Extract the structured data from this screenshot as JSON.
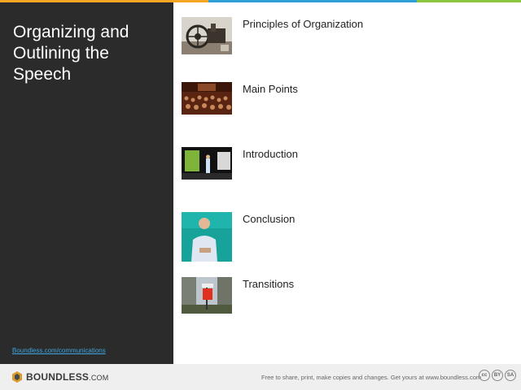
{
  "slide": {
    "title": "Organizing and Outlining the Speech",
    "source_link": "Boundless.com/communications"
  },
  "items": [
    {
      "label": "Principles of Organization",
      "image": "antique-machinery-photo"
    },
    {
      "label": "Main Points",
      "image": "audience-hall-photo"
    },
    {
      "label": "Introduction",
      "image": "stage-presenter-photo"
    },
    {
      "label": "Conclusion",
      "image": "speaker-portrait-photo"
    },
    {
      "label": "Transitions",
      "image": "street-sign-photo"
    }
  ],
  "footer": {
    "logo_main": "BOUNDLESS",
    "logo_suffix": ".COM",
    "note": "Free to share, print, make copies and changes. Get yours at www.boundless.com",
    "license_cc": "cc",
    "license_by": "BY",
    "license_sa": "SA"
  },
  "colors": {
    "stripe": [
      "#f5a623",
      "#f5a623",
      "#2f9fd8",
      "#2f9fd8",
      "#8cc63f"
    ],
    "left_panel": "#2b2b2b",
    "link": "#3ea6e0"
  }
}
